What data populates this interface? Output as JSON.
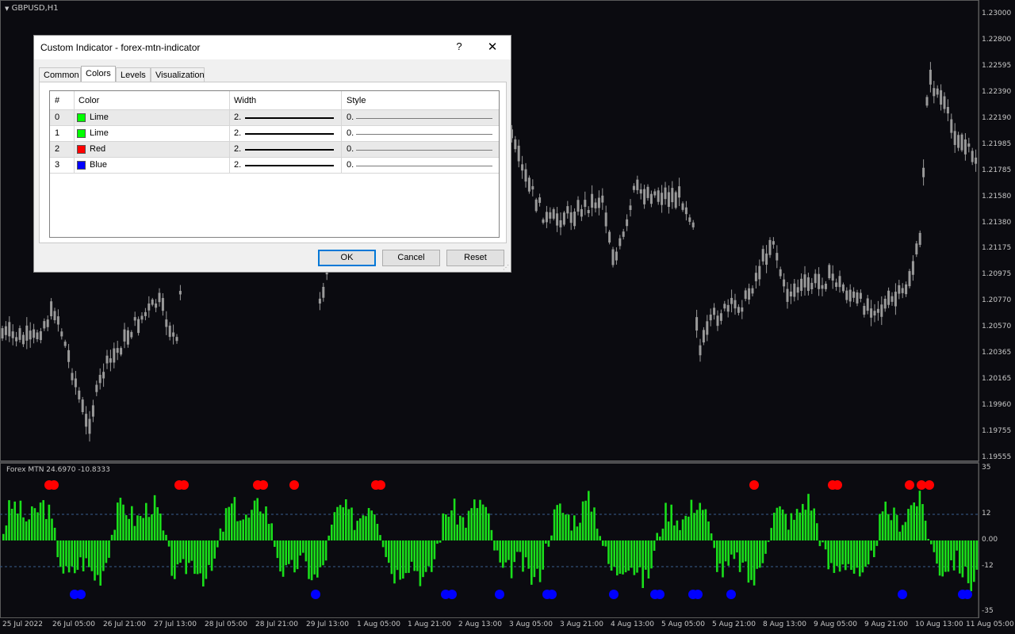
{
  "chart": {
    "symbol_label": "GBPUSD,H1",
    "indicator_label": "Forex MTN 24.6970 -10.8333",
    "price_ticks": [
      "1.23000",
      "1.22800",
      "1.22595",
      "1.22390",
      "1.22190",
      "1.21985",
      "1.21785",
      "1.21580",
      "1.21380",
      "1.21175",
      "1.20975",
      "1.20770",
      "1.20570",
      "1.20365",
      "1.20165",
      "1.19960",
      "1.19755",
      "1.19555"
    ],
    "indicator_ticks": [
      "35",
      "12",
      "0.00",
      "-12",
      "-35"
    ],
    "time_ticks": [
      "25 Jul 2022",
      "26 Jul 05:00",
      "26 Jul 21:00",
      "27 Jul 13:00",
      "28 Jul 05:00",
      "28 Jul 21:00",
      "29 Jul 13:00",
      "1 Aug 05:00",
      "1 Aug 21:00",
      "2 Aug 13:00",
      "3 Aug 05:00",
      "3 Aug 21:00",
      "4 Aug 13:00",
      "5 Aug 05:00",
      "5 Aug 21:00",
      "8 Aug 13:00",
      "9 Aug 05:00",
      "9 Aug 21:00",
      "10 Aug 13:00",
      "11 Aug 05:00"
    ],
    "colors": {
      "background": "#0b0b10",
      "candle": "#9a9a9a",
      "hist": "#1adf1a",
      "red_dot": "#ff0000",
      "blue_dot": "#0000ff",
      "level_line": "#3a5f8f"
    }
  },
  "dialog": {
    "title": "Custom Indicator - forex-mtn-indicator",
    "help_glyph": "?",
    "close_glyph": "✕",
    "tabs": [
      {
        "label": "Common",
        "active": false
      },
      {
        "label": "Colors",
        "active": true
      },
      {
        "label": "Levels",
        "active": false
      },
      {
        "label": "Visualization",
        "active": false
      }
    ],
    "columns": [
      "#",
      "Color",
      "Width",
      "Style"
    ],
    "rows": [
      {
        "index": "0",
        "color_name": "Lime",
        "color_hex": "#00ff00",
        "width": "2.",
        "style": "0."
      },
      {
        "index": "1",
        "color_name": "Lime",
        "color_hex": "#00ff00",
        "width": "2.",
        "style": "0."
      },
      {
        "index": "2",
        "color_name": "Red",
        "color_hex": "#ff0000",
        "width": "2.",
        "style": "0."
      },
      {
        "index": "3",
        "color_name": "Blue",
        "color_hex": "#0000ff",
        "width": "2.",
        "style": "0."
      }
    ],
    "buttons": {
      "ok": "OK",
      "cancel": "Cancel",
      "reset": "Reset"
    }
  }
}
